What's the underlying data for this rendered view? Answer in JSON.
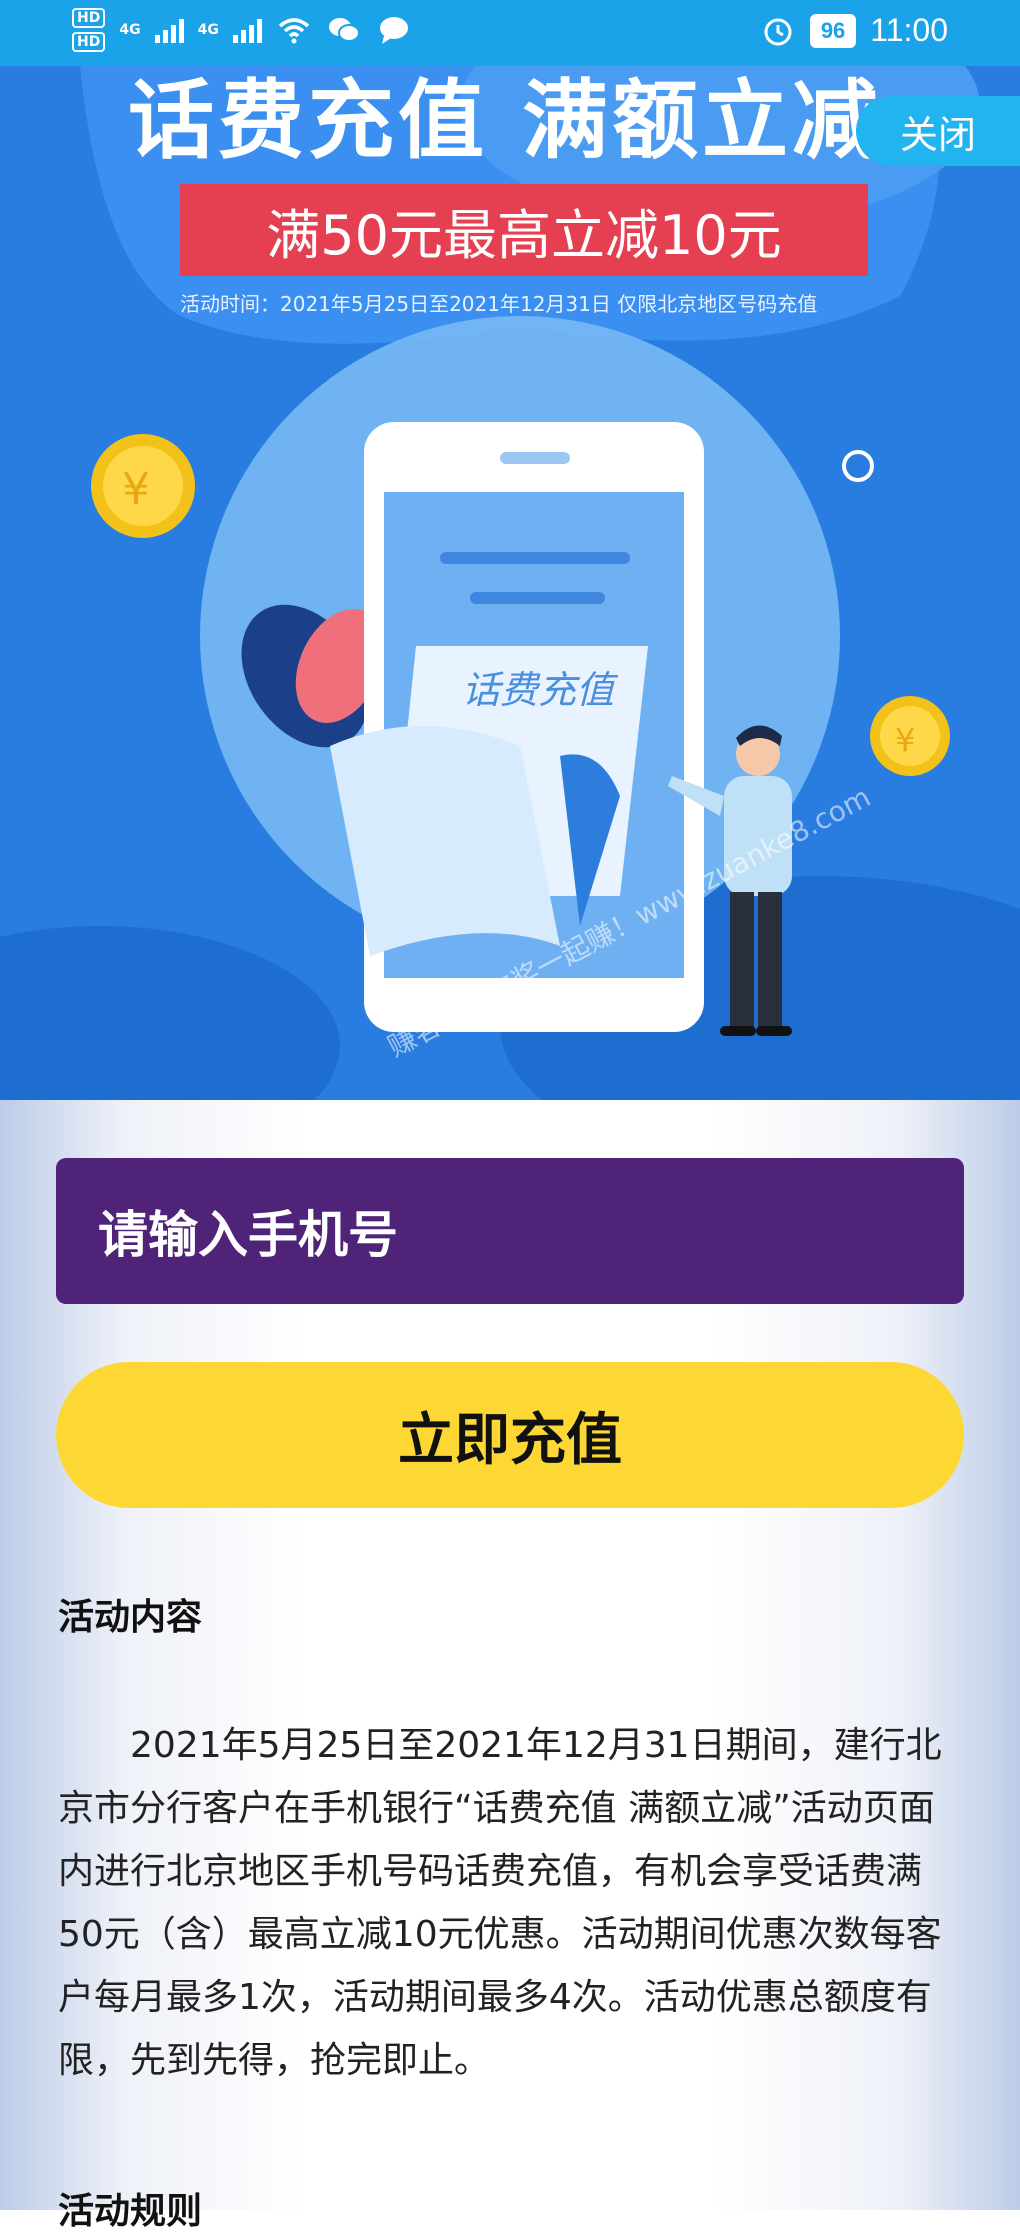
{
  "status_bar": {
    "hd1": "HD",
    "hd2": "HD",
    "net1": "4G",
    "net2": "4G",
    "battery": "96",
    "time": "11:00"
  },
  "banner": {
    "title": "话费充值 满额立减",
    "close_label": "关闭",
    "promo": "满50元最高立减10元",
    "period": "活动时间：2021年5月25日至2021年12月31日  仅限北京地区号码充值",
    "phone_label": "话费充值"
  },
  "form": {
    "phone_placeholder": "请输入手机号",
    "recharge_label": "立即充值"
  },
  "activity": {
    "section_title": "活动内容",
    "content": "2021年5月25日至2021年12月31日期间，建行北京市分行客户在手机银行“话费充值 满额立减”活动页面内进行北京地区手机号码话费充值，有机会享受话费满50元（含）最高立减10元优惠。活动期间优惠次数每客户每月最多1次，活动期间最多4次。活动优惠总额度有限，先到先得，抢完即止。",
    "rules_title": "活动规则"
  },
  "watermark": "赚客吧，有奖一起赚！www.zuanke8.com"
}
